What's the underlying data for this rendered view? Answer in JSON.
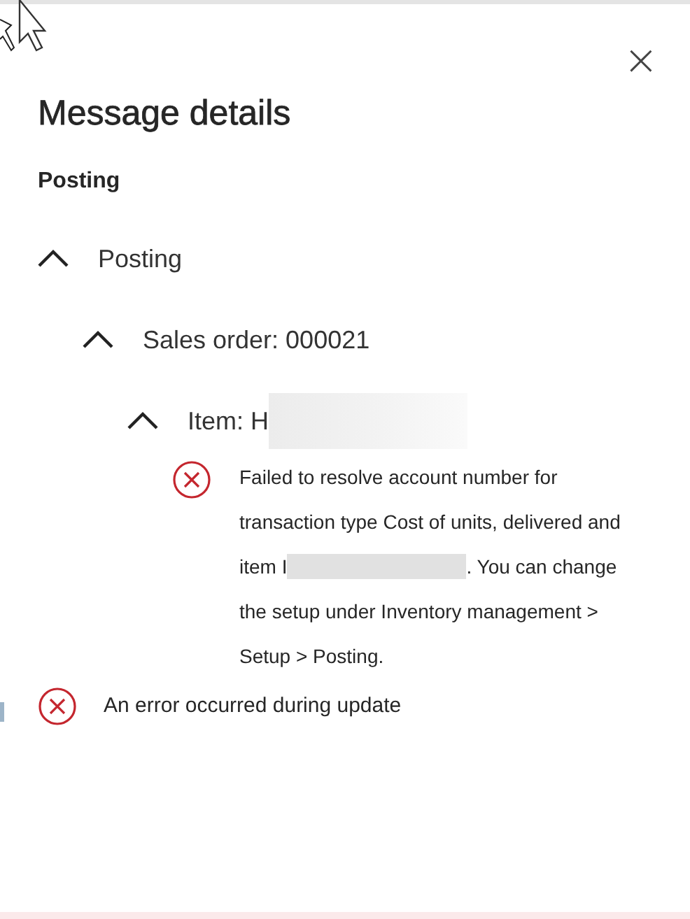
{
  "panel": {
    "title": "Message details",
    "close_label": "×"
  },
  "section": {
    "heading": "Posting",
    "tree": [
      {
        "label": "Posting",
        "expanded": true,
        "children": [
          {
            "label": "Sales order: 000021",
            "expanded": true,
            "children": [
              {
                "label": "Item: H",
                "redacted": true,
                "expanded": true,
                "messages": [
                  {
                    "kind": "error",
                    "lines": [
                      {
                        "text": "Failed to resolve account number for"
                      },
                      {
                        "text": "transaction type Cost of units, delivered and"
                      },
                      {
                        "before": "item I",
                        "redacted": true,
                        "after": ". You can change"
                      },
                      {
                        "text": "the setup under Inventory management >"
                      },
                      {
                        "text": "Setup > Posting."
                      }
                    ]
                  }
                ]
              }
            ]
          }
        ]
      }
    ]
  },
  "messages": [
    {
      "kind": "error",
      "text": "An error occurred during update"
    }
  ]
}
